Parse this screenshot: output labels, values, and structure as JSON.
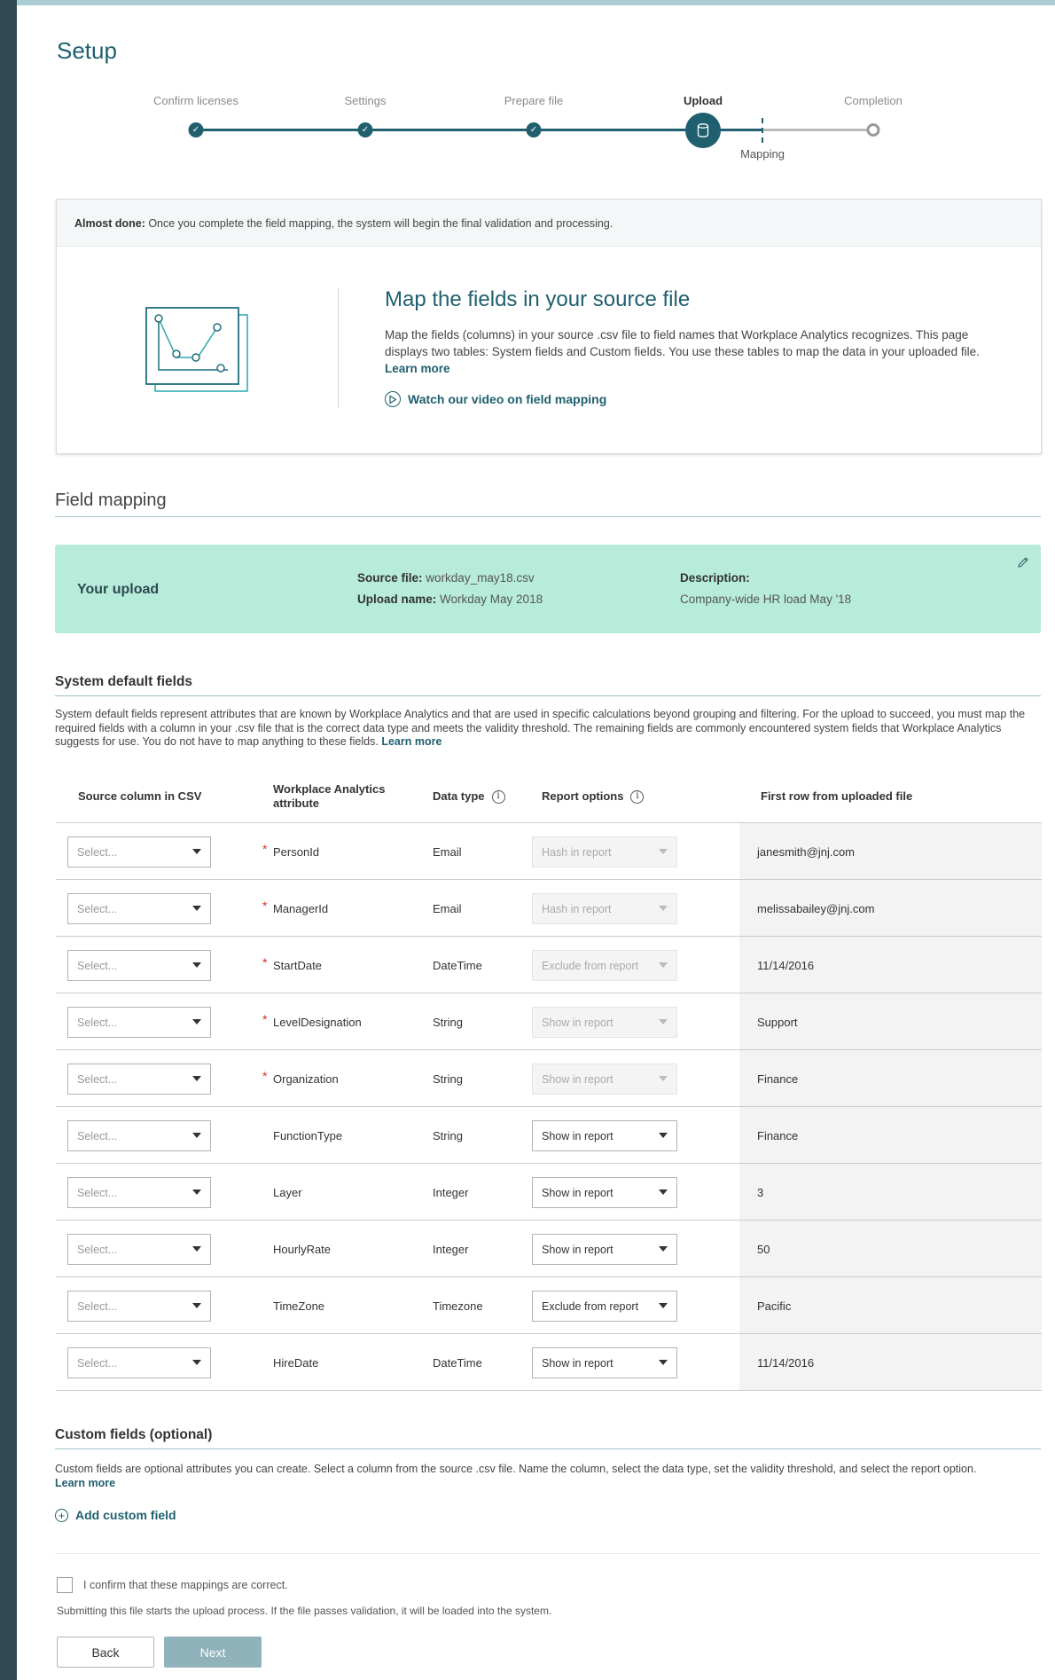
{
  "page": {
    "title": "Setup"
  },
  "stepper": {
    "steps": [
      {
        "label": "Confirm licenses",
        "state": "done"
      },
      {
        "label": "Settings",
        "state": "done"
      },
      {
        "label": "Prepare file",
        "state": "done"
      },
      {
        "label": "Upload",
        "state": "active"
      },
      {
        "label": "Completion",
        "state": "todo"
      }
    ],
    "substep": "Mapping",
    "active_icon": "database-icon"
  },
  "intro": {
    "banner_bold": "Almost done:",
    "banner_text": " Once you complete the field mapping, the system will begin the final validation and processing.",
    "title": "Map the fields in your source file",
    "text": "Map the fields (columns) in your source .csv file to field names that Workplace Analytics recognizes. This page displays two tables: System fields and Custom fields. You use these tables to map the data in your uploaded file.",
    "learn_more": "Learn more",
    "video_link": "Watch our video on field mapping"
  },
  "field_mapping": {
    "heading": "Field mapping"
  },
  "upload": {
    "title": "Your upload",
    "source_file_label": "Source file:",
    "source_file": "workday_may18.csv",
    "upload_name_label": "Upload name:",
    "upload_name": "Workday May 2018",
    "description_label": "Description:",
    "description": "Company-wide HR load May '18"
  },
  "system_fields": {
    "heading": "System default fields",
    "description": "System default fields represent attributes that are known by Workplace Analytics and that are used in specific calculations beyond grouping and filtering. For the upload to succeed, you must map the required fields with a column in your .csv file that is the correct data type and meets the validity threshold. The remaining fields are commonly encountered system fields that Workplace Analytics suggests for use. You do not have to map anything to these fields.",
    "learn_more": "Learn more",
    "columns": {
      "source": "Source column in CSV",
      "attribute_line1": "Workplace Analytics",
      "attribute_line2": "attribute",
      "datatype": "Data type",
      "report": "Report options",
      "firstrow": "First row from uploaded file"
    },
    "rows": [
      {
        "select": "Select...",
        "required": "*",
        "attribute": "PersonId",
        "datatype": "Email",
        "report": "Hash in report",
        "report_enabled": false,
        "firstrow": "janesmith@jnj.com"
      },
      {
        "select": "Select...",
        "required": "*",
        "attribute": "ManagerId",
        "datatype": "Email",
        "report": "Hash in report",
        "report_enabled": false,
        "firstrow": "melissabailey@jnj.com"
      },
      {
        "select": "Select...",
        "required": "*",
        "attribute": "StartDate",
        "datatype": "DateTime",
        "report": "Exclude from report",
        "report_enabled": false,
        "firstrow": "11/14/2016"
      },
      {
        "select": "Select...",
        "required": "*",
        "attribute": "LevelDesignation",
        "datatype": "String",
        "report": "Show in report",
        "report_enabled": false,
        "firstrow": "Support"
      },
      {
        "select": "Select...",
        "required": "*",
        "attribute": "Organization",
        "datatype": "String",
        "report": "Show in report",
        "report_enabled": false,
        "firstrow": "Finance"
      },
      {
        "select": "Select...",
        "required": "",
        "attribute": "FunctionType",
        "datatype": "String",
        "report": "Show in report",
        "report_enabled": true,
        "firstrow": "Finance"
      },
      {
        "select": "Select...",
        "required": "",
        "attribute": "Layer",
        "datatype": "Integer",
        "report": "Show in report",
        "report_enabled": true,
        "firstrow": "3"
      },
      {
        "select": "Select...",
        "required": "",
        "attribute": "HourlyRate",
        "datatype": "Integer",
        "report": "Show in report",
        "report_enabled": true,
        "firstrow": "50"
      },
      {
        "select": "Select...",
        "required": "",
        "attribute": "TimeZone",
        "datatype": "Timezone",
        "report": "Exclude from report",
        "report_enabled": true,
        "firstrow": "Pacific"
      },
      {
        "select": "Select...",
        "required": "",
        "attribute": "HireDate",
        "datatype": "DateTime",
        "report": "Show in report",
        "report_enabled": true,
        "firstrow": "11/14/2016"
      }
    ]
  },
  "custom_fields": {
    "heading": "Custom fields (optional)",
    "description": "Custom fields are optional attributes you can create. Select a column from the source .csv file. Name the column, select the data type, set the validity threshold, and select the report option.",
    "learn_more": "Learn more",
    "add_label": "Add custom field"
  },
  "footer": {
    "confirm_label": "I confirm that these mappings are correct.",
    "submit_note": "Submitting this file starts the upload process. If the file passes validation, it will be loaded into the system.",
    "back_label": "Back",
    "next_label": "Next"
  },
  "colors": {
    "accent": "#1f5f6e",
    "upload_bg": "#b7ebda",
    "sidebar": "#2f4a55",
    "next_disabled": "#8fb2bb"
  }
}
